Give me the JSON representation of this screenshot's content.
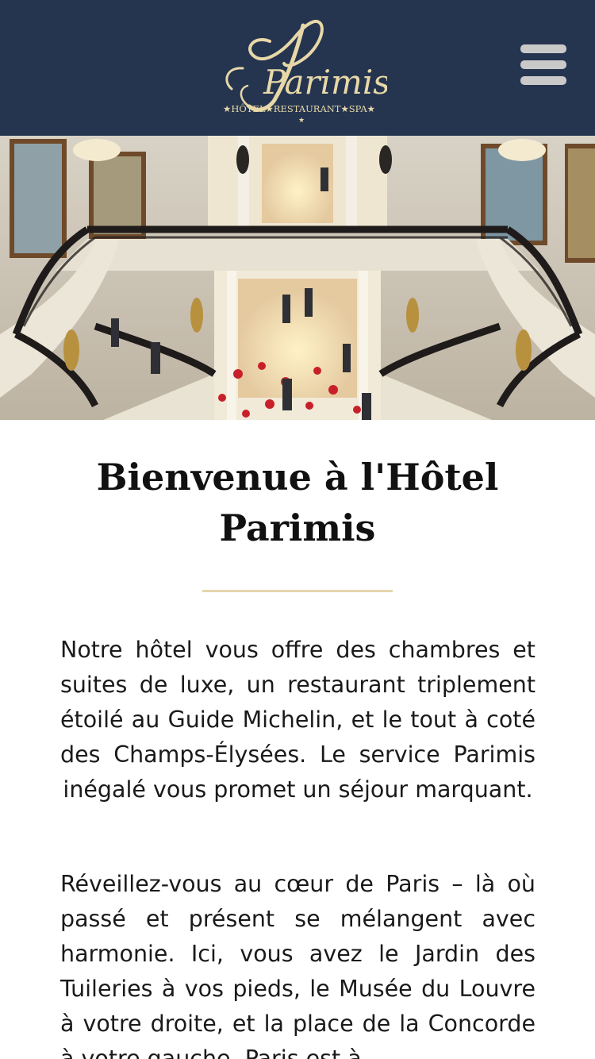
{
  "header": {
    "logo_name": "Parimis",
    "logo_tagline": "★HÔTEL★RESTAURANT★SPA★",
    "menu_icon": "hamburger-menu-icon",
    "background_color": "#253550",
    "logo_color": "#e8d8a8"
  },
  "hero": {
    "image": "grand-staircase-lobby"
  },
  "main": {
    "title": "Bienvenue à l'Hôtel Parimis",
    "divider_color": "#e6d6ad",
    "paragraphs": [
      "Notre hôtel vous offre des chambres et suites de luxe, un restaurant triplement étoilé au Guide Michelin, et le tout à coté des Champs-Élysées. Le service Parimis inégalé vous promet un séjour marquant.",
      "Réveillez-vous au cœur de Paris – là où passé et présent se mélangent avec harmonie. Ici, vous avez le Jardin des Tuileries à vos pieds, le Musée du Louvre à votre droite, et la place de la Concorde à votre gauche. Paris est à"
    ]
  }
}
